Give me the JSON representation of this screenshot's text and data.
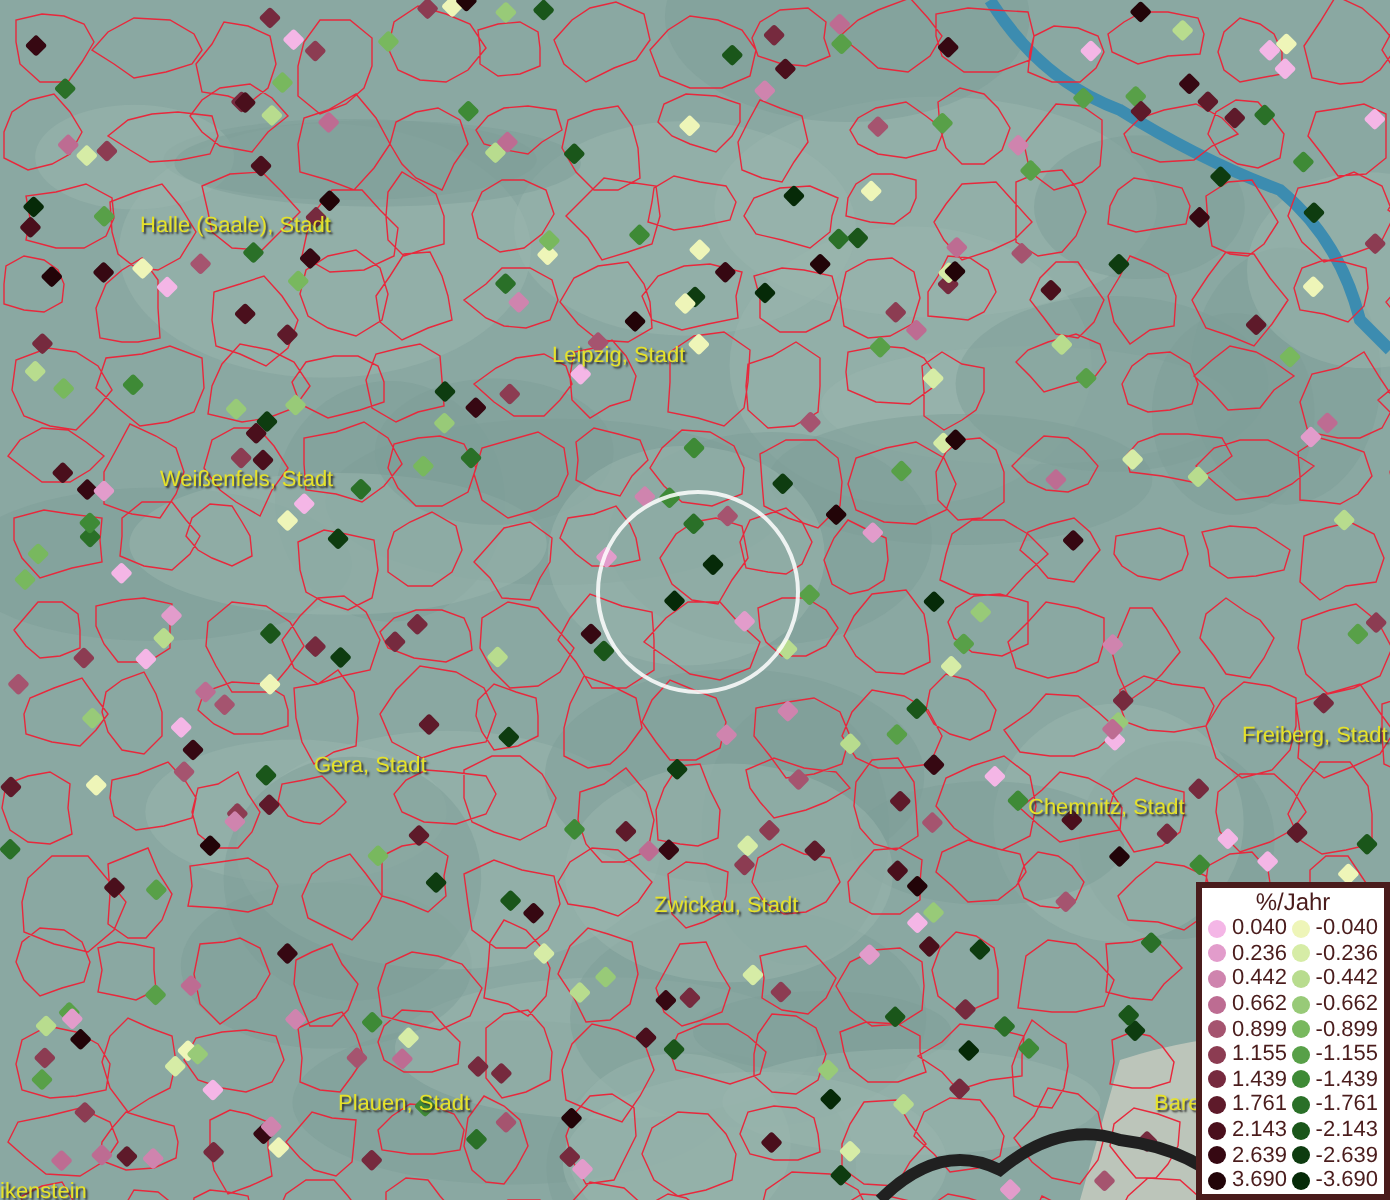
{
  "map": {
    "places": [
      {
        "label": "Halle (Saale), Stadt"
      },
      {
        "label": "Leipzig, Stadt"
      },
      {
        "label": "Weißenfels, Stadt"
      },
      {
        "label": "Gera, Stadt"
      },
      {
        "label": "Freiberg, Stadt"
      },
      {
        "label": "Chemnitz, Stadt"
      },
      {
        "label": "Zwickau, Stadt"
      },
      {
        "label": "Plauen, Stadt"
      },
      {
        "label": "Bare"
      },
      {
        "label": "ikenstein"
      }
    ]
  },
  "legend": {
    "title": "%/Jahr",
    "positive": [
      {
        "label": "0.040",
        "color": "#f4b6e6"
      },
      {
        "label": "0.236",
        "color": "#e29ccb"
      },
      {
        "label": "0.442",
        "color": "#cf84ae"
      },
      {
        "label": "0.662",
        "color": "#bd6c92"
      },
      {
        "label": "0.899",
        "color": "#a5546f"
      },
      {
        "label": "1.155",
        "color": "#8c3c52"
      },
      {
        "label": "1.439",
        "color": "#762a3e"
      },
      {
        "label": "1.761",
        "color": "#5e1a2a"
      },
      {
        "label": "2.143",
        "color": "#4a0f1c"
      },
      {
        "label": "2.639",
        "color": "#360812"
      },
      {
        "label": "3.690",
        "color": "#220408"
      }
    ],
    "negative": [
      {
        "label": "-0.040",
        "color": "#eef5b8"
      },
      {
        "label": "-0.236",
        "color": "#d6eca6"
      },
      {
        "label": "-0.442",
        "color": "#b8dc8e"
      },
      {
        "label": "-0.662",
        "color": "#98ca78"
      },
      {
        "label": "-0.899",
        "color": "#78b85e"
      },
      {
        "label": "-1.155",
        "color": "#58a048"
      },
      {
        "label": "-1.439",
        "color": "#3e8a36"
      },
      {
        "label": "-1.761",
        "color": "#2a7028"
      },
      {
        "label": "-2.143",
        "color": "#1a561a"
      },
      {
        "label": "-2.639",
        "color": "#0e3c10"
      },
      {
        "label": "-3.690",
        "color": "#062a08"
      }
    ]
  }
}
